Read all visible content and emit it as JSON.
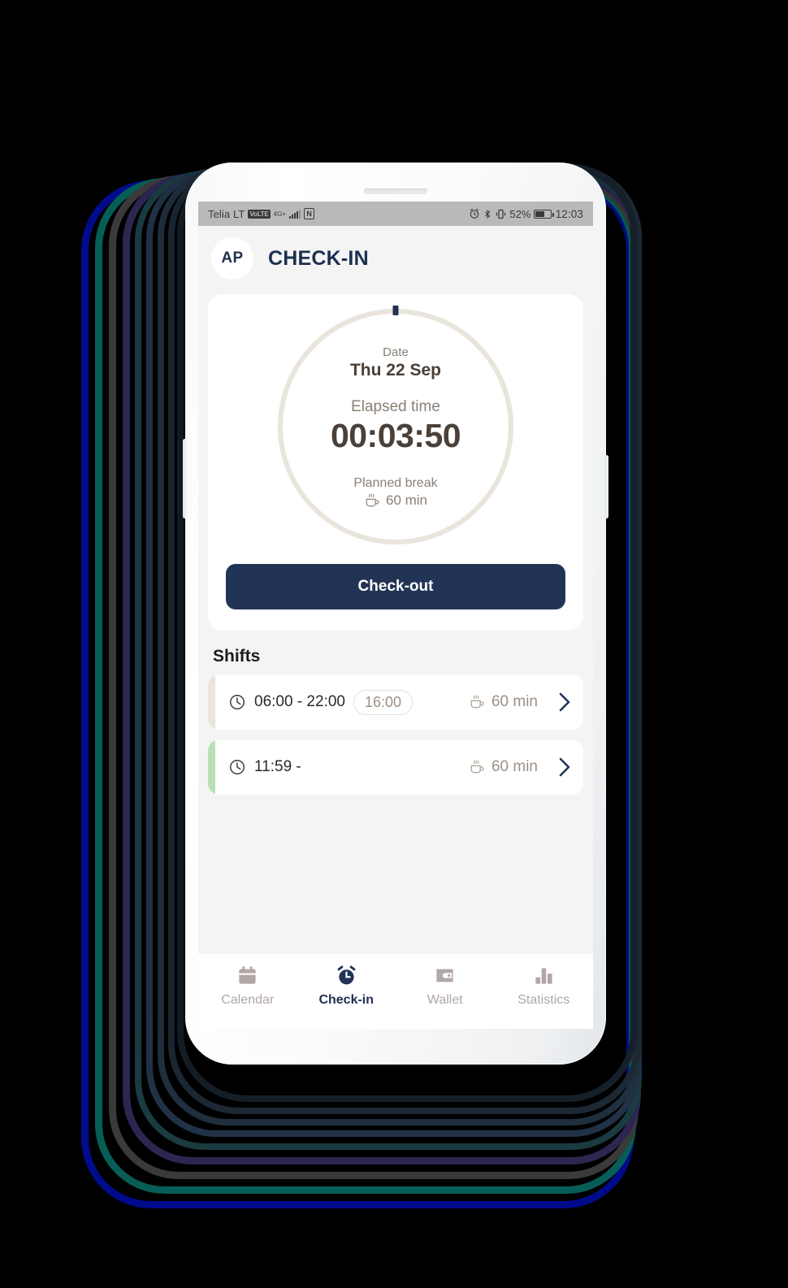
{
  "statusbar": {
    "carrier": "Telia LT",
    "volte": "VoLTE",
    "network": "4G+",
    "nfc": "N",
    "battery_pct": "52%",
    "time": "12:03"
  },
  "header": {
    "avatar_initials": "AP",
    "title": "CHECK-IN"
  },
  "timer": {
    "date_label": "Date",
    "date_value": "Thu 22 Sep",
    "elapsed_label": "Elapsed time",
    "elapsed_value": "00:03:50",
    "break_label": "Planned break",
    "break_value": "60 min",
    "checkout_button": "Check-out"
  },
  "shifts": {
    "title": "Shifts",
    "rows": [
      {
        "time": "06:00 - 22:00",
        "duration_badge": "16:00",
        "break": "60 min",
        "accent_color": "#e9e4dc"
      },
      {
        "time": "11:59 -",
        "duration_badge": "",
        "break": "60 min",
        "accent_color": "#b9e0b4"
      }
    ]
  },
  "bottom_nav": {
    "items": [
      {
        "label": "Calendar",
        "icon": "calendar-icon",
        "active": false
      },
      {
        "label": "Check-in",
        "icon": "alarm-clock-icon",
        "active": true
      },
      {
        "label": "Wallet",
        "icon": "wallet-icon",
        "active": false
      },
      {
        "label": "Statistics",
        "icon": "bar-chart-icon",
        "active": false
      }
    ]
  },
  "colors": {
    "navy": "#223455",
    "app_bg": "#f4f4f5",
    "card": "#ffffff",
    "taupe": "#8a8076",
    "ring": "#e9e4dc",
    "green_accent": "#b9e0b4",
    "muted_icon": "#b2a6a6"
  }
}
